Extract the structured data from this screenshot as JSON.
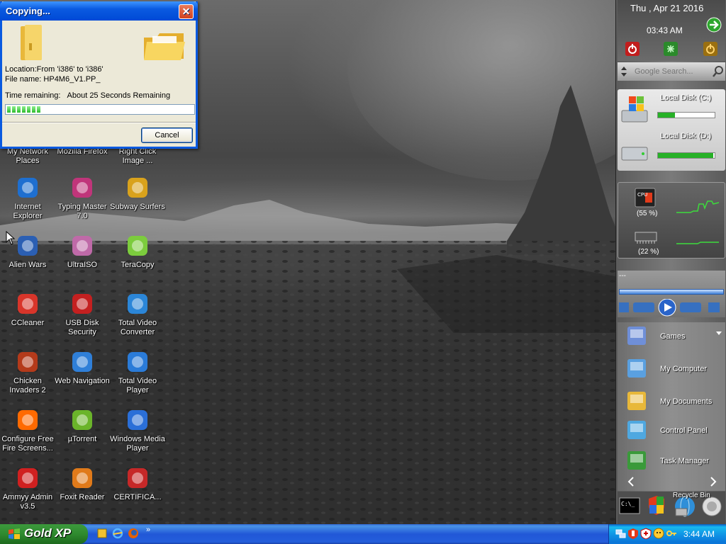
{
  "dialog": {
    "title": "Copying...",
    "location": "Location:From 'i386' to 'i386'",
    "file_name": "File name: HP4M6_V1.PP_",
    "time_remaining_label": "Time remaining:",
    "time_remaining_value": "About   25 Seconds Remaining",
    "progress": 0.16,
    "cancel_label": "Cancel",
    "close_glyph": "✕"
  },
  "desktop_icons": [
    {
      "label": "My Network Places",
      "icon": "network-places-icon"
    },
    {
      "label": "Mozilla Firefox",
      "icon": "firefox-icon"
    },
    {
      "label": "Right Click Image ...",
      "icon": "right-click-image-icon"
    },
    {
      "label": "Internet Explorer",
      "icon": "internet-explorer-icon"
    },
    {
      "label": "Typing Master 7.0",
      "icon": "typing-master-icon"
    },
    {
      "label": "Subway Surfers",
      "icon": "subway-surfers-icon"
    },
    {
      "label": "Alien Wars",
      "icon": "alien-wars-icon"
    },
    {
      "label": "UltraISO",
      "icon": "ultraiso-icon"
    },
    {
      "label": "TeraCopy",
      "icon": "teracopy-icon"
    },
    {
      "label": "CCleaner",
      "icon": "ccleaner-icon"
    },
    {
      "label": "USB Disk Security",
      "icon": "usb-disk-security-icon"
    },
    {
      "label": "Total Video Converter",
      "icon": "total-video-converter-icon"
    },
    {
      "label": "Chicken Invaders 2",
      "icon": "chicken-invaders-icon"
    },
    {
      "label": "Web Navigation",
      "icon": "web-navigation-icon"
    },
    {
      "label": "Total Video Player",
      "icon": "total-video-player-icon"
    },
    {
      "label": "Configure Free Fire Screens...",
      "icon": "fire-screensaver-icon"
    },
    {
      "label": "µTorrent",
      "icon": "utorrent-icon"
    },
    {
      "label": "Windows Media Player",
      "icon": "windows-media-player-icon"
    },
    {
      "label": "Ammyy Admin v3.5",
      "icon": "ammyy-admin-icon"
    },
    {
      "label": "Foxit Reader",
      "icon": "foxit-reader-icon"
    },
    {
      "label": "CERTIFICA...",
      "icon": "pdf-file-icon"
    }
  ],
  "sidebar": {
    "date": "Thu , Apr 21 2016",
    "time": "03:43 AM",
    "search_placeholder": "Google Search...",
    "disks": [
      {
        "label": "Local Disk (C:)",
        "used": 0.3
      },
      {
        "label": "Local Disk (D:)",
        "used": 0.98
      }
    ],
    "cpu_label": "CPU",
    "cpu_percent": "(55 %)",
    "ram_percent": "(22 %)",
    "media_title": "---",
    "launch_items": [
      {
        "label": "Games",
        "icon": "games-folder-icon"
      },
      {
        "label": "My Computer",
        "icon": "my-computer-icon"
      },
      {
        "label": "My Documents",
        "icon": "my-documents-icon"
      },
      {
        "label": "Control Panel",
        "icon": "control-panel-icon"
      },
      {
        "label": "Task Manager",
        "icon": "task-manager-icon"
      }
    ],
    "recycle_label": "Recycle Bin"
  },
  "taskbar": {
    "start_label": "Gold XP",
    "clock": "3:44 AM"
  },
  "colors": {
    "xp_blue": "#0a5ae0",
    "start_green": "#2f8a2f",
    "progress_green": "#2dbb2d"
  }
}
